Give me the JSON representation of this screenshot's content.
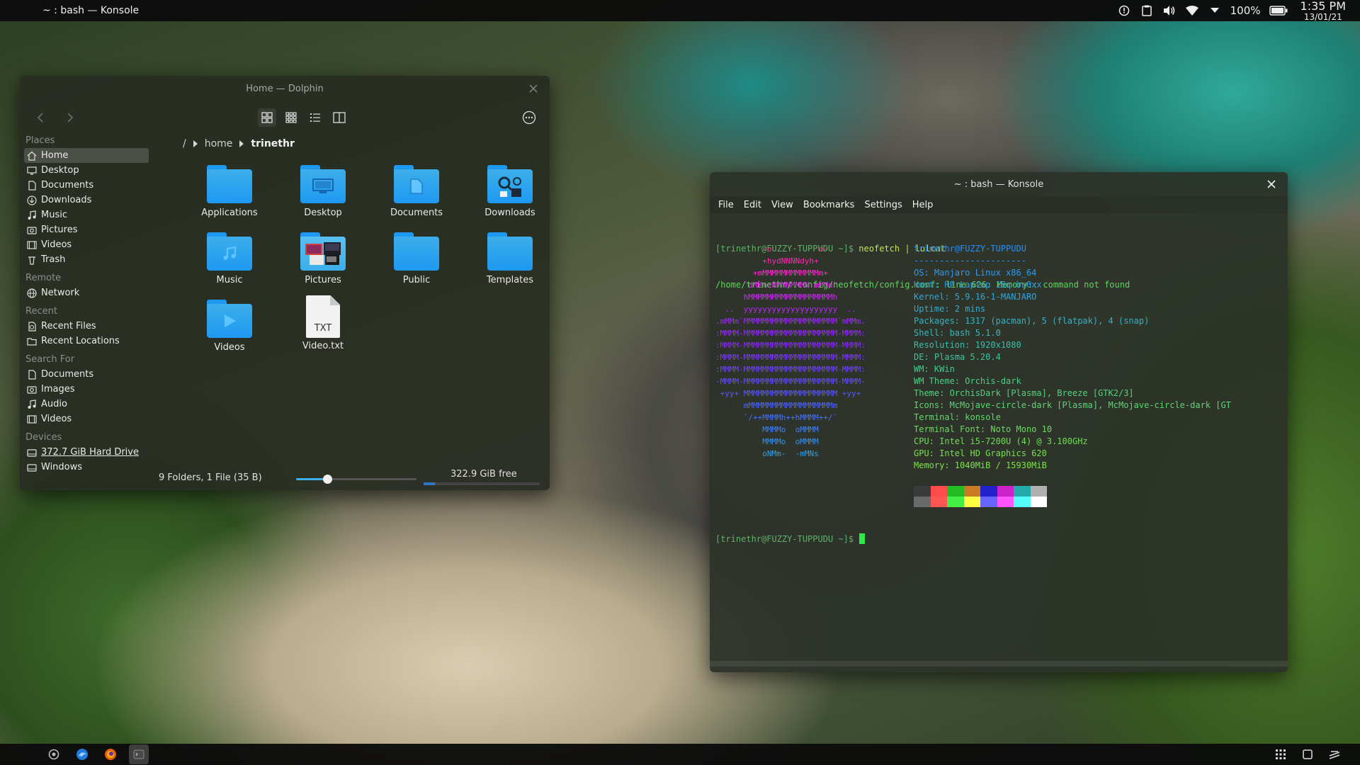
{
  "top_panel": {
    "window_title": "~ : bash — Konsole",
    "battery": "100%",
    "time": "1:35 PM",
    "date": "13/01/21",
    "icons": [
      "info-icon",
      "clipboard-icon",
      "volume-icon",
      "wifi-icon",
      "arrow-down-icon",
      "battery-icon"
    ]
  },
  "dolphin": {
    "title": "Home — Dolphin",
    "sidebar": {
      "places_header": "Places",
      "places": [
        {
          "label": "Home",
          "icon": "home-icon"
        },
        {
          "label": "Desktop",
          "icon": "desktop-icon"
        },
        {
          "label": "Documents",
          "icon": "documents-icon"
        },
        {
          "label": "Downloads",
          "icon": "downloads-icon"
        },
        {
          "label": "Music",
          "icon": "music-icon"
        },
        {
          "label": "Pictures",
          "icon": "pictures-icon"
        },
        {
          "label": "Videos",
          "icon": "videos-icon"
        },
        {
          "label": "Trash",
          "icon": "trash-icon"
        }
      ],
      "remote_header": "Remote",
      "remote": [
        {
          "label": "Network",
          "icon": "network-icon"
        }
      ],
      "recent_header": "Recent",
      "recent": [
        {
          "label": "Recent Files",
          "icon": "recent-files-icon"
        },
        {
          "label": "Recent Locations",
          "icon": "recent-locations-icon"
        }
      ],
      "search_header": "Search For",
      "search": [
        {
          "label": "Documents",
          "icon": "documents-icon"
        },
        {
          "label": "Images",
          "icon": "images-icon"
        },
        {
          "label": "Audio",
          "icon": "audio-icon"
        },
        {
          "label": "Videos",
          "icon": "videos-icon"
        }
      ],
      "devices_header": "Devices",
      "devices": [
        {
          "label": "372.7 GiB Hard Drive",
          "icon": "hard-drive-icon"
        },
        {
          "label": "Windows",
          "icon": "hard-drive-icon"
        }
      ]
    },
    "breadcrumb": {
      "root": "/",
      "parts": [
        "home",
        "trinethr"
      ]
    },
    "files": [
      {
        "label": "Applications",
        "type": "folder",
        "glyph": ""
      },
      {
        "label": "Desktop",
        "type": "folder",
        "glyph": "desktop"
      },
      {
        "label": "Documents",
        "type": "folder",
        "glyph": "document"
      },
      {
        "label": "Downloads",
        "type": "folder",
        "glyph": "downloads"
      },
      {
        "label": "Music",
        "type": "folder",
        "glyph": "music"
      },
      {
        "label": "Pictures",
        "type": "folder",
        "glyph": "pictures"
      },
      {
        "label": "Public",
        "type": "folder",
        "glyph": ""
      },
      {
        "label": "Templates",
        "type": "folder",
        "glyph": ""
      },
      {
        "label": "Videos",
        "type": "folder",
        "glyph": "video"
      },
      {
        "label": "Video.txt",
        "type": "txt",
        "glyph": "TXT"
      }
    ],
    "status": {
      "summary": "9 Folders, 1 File (35 B)",
      "zoom_fraction": 0.26,
      "free_space": "322.9 GiB free",
      "used_fraction": 0.1
    }
  },
  "konsole": {
    "title": "~ : bash — Konsole",
    "menu": [
      "File",
      "Edit",
      "View",
      "Bookmarks",
      "Settings",
      "Help"
    ],
    "command_line": {
      "prompt": "[trinethr@FUZZY-TUPPUDU ~]$",
      "command": " neofetch | lolcat"
    },
    "error_line": "/home/trinethr/.config/neofetch/config.conf: line 626: Memory:: command not found",
    "ascii_art": [
      "          -o          o-",
      "          +hydNNNNdyh+",
      "        +mMMMMMMMMMMMMm+",
      "      `dMMm:NMMMMMMN:mMMd`",
      "      hMMMMMMMMMMMMMMMMMMh",
      "  ..  yyyyyyyyyyyyyyyyyyyy  ..",
      ".mMMm`MMMMMMMMMMMMMMMMMMMM`mMMm.",
      ":MMMM-MMMMMMMMMMMMMMMMMMMM-MMMM:",
      ":MMMM-MMMMMMMMMMMMMMMMMMMM-MMMM:",
      ":MMMM-MMMMMMMMMMMMMMMMMMMM-MMMM:",
      ":MMMM-MMMMMMMMMMMMMMMMMMMM-MMMM:",
      "-MMMM-MMMMMMMMMMMMMMMMMMMM-MMMM-",
      " +yy+ MMMMMMMMMMMMMMMMMMMM +yy+",
      "      mMMMMMMMMMMMMMMMMMMm",
      "      `/++MMMMh++hMMMM++/`",
      "          MMMMo  oMMMM",
      "          MMMMo  oMMMM",
      "          oNMm-  -mMNs"
    ],
    "ascii_colors": [
      "#ff2a8a",
      "#ff2ab0",
      "#ff2ad2",
      "#e72af0",
      "#d02af8",
      "#bb2afc",
      "#a12aff",
      "#962aff",
      "#8a2aff",
      "#7d3aff",
      "#7044ff",
      "#6a4cff",
      "#5a58ff",
      "#4f66ff",
      "#4672ff",
      "#3d82ff",
      "#3592f0",
      "#2fa0e6"
    ],
    "info": [
      "trinethr@FUZZY-TUPPUDU",
      "----------------------",
      "OS: Manjaro Linux x86_64",
      "Host: HP Laptop 15q-bu0xx",
      "Kernel: 5.9.16-1-MANJARO",
      "Uptime: 2 mins",
      "Packages: 1317 (pacman), 5 (flatpak), 4 (snap)",
      "Shell: bash 5.1.0",
      "Resolution: 1920x1080",
      "DE: Plasma 5.20.4",
      "WM: KWin",
      "WM Theme: Orchis-dark",
      "Theme: OrchisDark [Plasma], Breeze [GTK2/3]",
      "Icons: McMojave-circle-dark [Plasma], McMojave-circle-dark [GT",
      "Terminal: konsole",
      "Terminal Font: Noto Mono 10",
      "CPU: Intel i5-7200U (4) @ 3.100GHz",
      "GPU: Intel HD Graphics 620",
      "Memory: 1040MiB / 15930MiB"
    ],
    "info_colors": [
      "#1e90ff",
      "#2692ff",
      "#2e99f0",
      "#2e9fe6",
      "#2ea6dc",
      "#30acd0",
      "#33b2c4",
      "#36b8b8",
      "#3abeac",
      "#3ec4a0",
      "#44c994",
      "#4bce88",
      "#52d27c",
      "#5ad672",
      "#61d968",
      "#68dc5e",
      "#6fde55",
      "#76e04c",
      "#7ee244"
    ],
    "palette_top": [
      "#3a3a3a",
      "#ff4b4b",
      "#22bb22",
      "#cc7a22",
      "#2222cc",
      "#cc22cc",
      "#22aaaa",
      "#b0b0b0"
    ],
    "palette_bottom": [
      "#6a6a6a",
      "#ff5555",
      "#44ee44",
      "#ffff44",
      "#6666ff",
      "#ff55ff",
      "#55ffff",
      "#ffffff"
    ],
    "prompt2": "[trinethr@FUZZY-TUPPUDU ~]$"
  },
  "taskbar": {
    "launchers": [
      "menu-icon",
      "browser-icon",
      "firefox-icon",
      "konsole-icon"
    ],
    "tray": [
      "apps-grid-icon",
      "show-desktop-icon",
      "notifications-icon"
    ]
  }
}
